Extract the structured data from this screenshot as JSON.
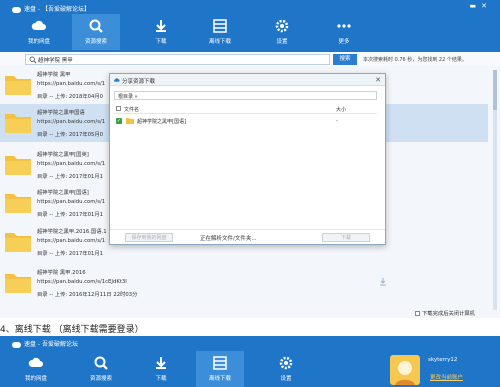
{
  "window": {
    "title": "速盘 - 【吾爱破解论坛】",
    "controls": [
      "▬",
      "✕"
    ]
  },
  "nav": [
    {
      "label": "我的网盘",
      "icon": "cloud-icon"
    },
    {
      "label": "资源搜索",
      "icon": "search-icon",
      "active": true
    },
    {
      "label": "下载",
      "icon": "download-icon"
    },
    {
      "label": "离线下载",
      "icon": "list-icon"
    },
    {
      "label": "设置",
      "icon": "gear-icon"
    },
    {
      "label": "更多",
      "icon": "more-icon"
    }
  ],
  "search": {
    "query": "超神学院 黑甲",
    "button_label": "搜索",
    "status": "本次搜索耗时 0.76 秒，为您找到 22 个结果。"
  },
  "results": [
    {
      "title": "超神学院 黑甲",
      "url": "https://pan.baidu.com/s/1",
      "meta": "目录 -- 上传: 2018年04月0"
    },
    {
      "title": "超神学院之黑甲国语",
      "url": "https://pan.baidu.com/s/1",
      "meta": "目录 -- 上传: 2017年05月0"
    },
    {
      "title": "超神学院之黑甲[国英]",
      "url": "https://pan.baidu.com/s/1",
      "meta": "目录 -- 上传: 2017年01月1"
    },
    {
      "title": "超神学院之黑甲[国语]",
      "url": "https://pan.baidu.com/s/1",
      "meta": "目录 -- 上传: 2017年01月1"
    },
    {
      "title": "超神学院之黑甲.2016.国语.1",
      "url": "https://pan.baidu.com/s/1",
      "meta": "目录 -- 上传: 2017年01月1"
    },
    {
      "title": "超神学院 黑甲.2016",
      "url": "https://pan.baidu.com/s/1cEJdKt3I",
      "meta": "目录 -- 上传: 2016年12月11日 22时03分"
    }
  ],
  "options": {
    "offline_label": "下载完成后关闭计算机"
  },
  "dialog": {
    "title": "分享资源下载",
    "path": "根目录 »",
    "col_name": "文件名",
    "col_size": "大小",
    "file": {
      "name": "超神学院之黑甲[国语]",
      "size": "-"
    },
    "save_label": "保存到我的网盘",
    "parse_status": "正在解析文件/文件夹...",
    "download_label": "下载"
  },
  "caption": "4、离线下载 （离线下载需要登录）",
  "second_window": {
    "title": "速盘 - 吾爱破解论坛",
    "nav": [
      {
        "label": "我的网盘",
        "icon": "cloud-icon"
      },
      {
        "label": "资源搜索",
        "icon": "search-icon"
      },
      {
        "label": "下载",
        "icon": "download-icon"
      },
      {
        "label": "离线下载",
        "icon": "list-icon",
        "active": true
      },
      {
        "label": "设置",
        "icon": "gear-icon"
      }
    ],
    "user": {
      "name": "skyterry12",
      "link": "更改当前账户"
    }
  }
}
